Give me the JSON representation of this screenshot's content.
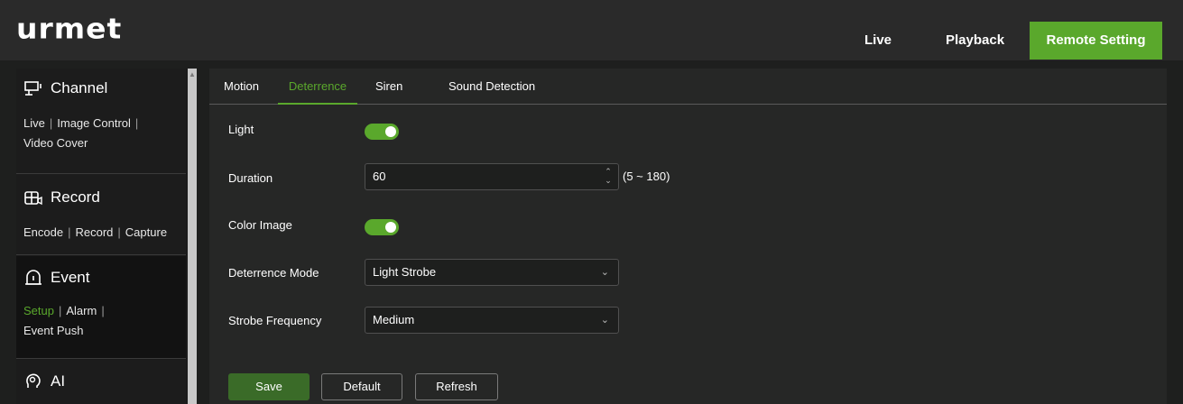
{
  "header": {
    "logo_text": "urmet",
    "nav": [
      "Live",
      "Playback",
      "Remote Setting"
    ],
    "active_nav": "Remote Setting",
    "accent_color": "#5aa82c"
  },
  "sidebar": {
    "channel": {
      "title": "Channel",
      "icon": "monitor-icon",
      "links": [
        "Live",
        "Image Control",
        "Video Cover"
      ]
    },
    "record": {
      "title": "Record",
      "icon": "record-icon",
      "links": [
        "Encode",
        "Record",
        "Capture"
      ]
    },
    "event": {
      "title": "Event",
      "icon": "alarm-icon",
      "links": [
        "Setup",
        "Alarm",
        "Event Push"
      ],
      "active_link": "Setup"
    },
    "ai": {
      "title": "AI",
      "icon": "ai-head-icon"
    }
  },
  "tabs": [
    "Motion",
    "Deterrence",
    "Siren",
    "Sound Detection"
  ],
  "active_tab": "Deterrence",
  "form": {
    "light": {
      "label": "Light",
      "on": true
    },
    "duration": {
      "label": "Duration",
      "value": "60",
      "range": "(5 ~ 180)"
    },
    "color_image": {
      "label": "Color Image",
      "on": true
    },
    "deterrence_mode": {
      "label": "Deterrence Mode",
      "value": "Light Strobe"
    },
    "strobe_frequency": {
      "label": "Strobe Frequency",
      "value": "Medium"
    }
  },
  "buttons": {
    "save": "Save",
    "default": "Default",
    "refresh": "Refresh"
  }
}
